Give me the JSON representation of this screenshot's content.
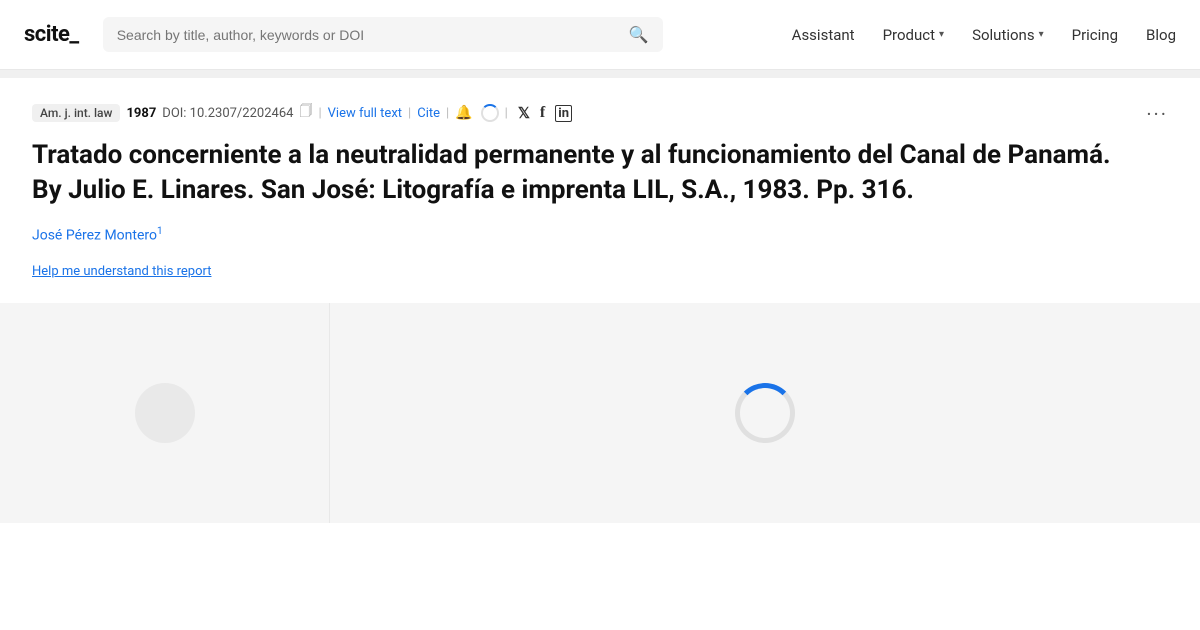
{
  "logo": {
    "text": "scite_"
  },
  "search": {
    "placeholder": "Search by title, author, keywords or DOI"
  },
  "nav": {
    "items": [
      {
        "label": "Assistant",
        "hasDropdown": false
      },
      {
        "label": "Product",
        "hasDropdown": true
      },
      {
        "label": "Solutions",
        "hasDropdown": true
      },
      {
        "label": "Pricing",
        "hasDropdown": false
      },
      {
        "label": "Blog",
        "hasDropdown": false
      }
    ]
  },
  "article": {
    "journal": "Am. j. int. law",
    "year": "1987",
    "doi": "DOI: 10.2307/2202464",
    "view_full_text": "View full text",
    "cite": "Cite",
    "title": "Tratado concerniente a la neutralidad permanente y al funcionamiento del Canal de Panamá. By Julio E. Linares. San José: Litografía e imprenta LIL, S.A., 1983. Pp. 316.",
    "author": "José Pérez Montero",
    "author_superscript": "1",
    "help_link": "Help me understand this report",
    "more_button": "···",
    "social": {
      "twitter": "𝕏",
      "facebook": "f",
      "linkedin": "in"
    }
  }
}
